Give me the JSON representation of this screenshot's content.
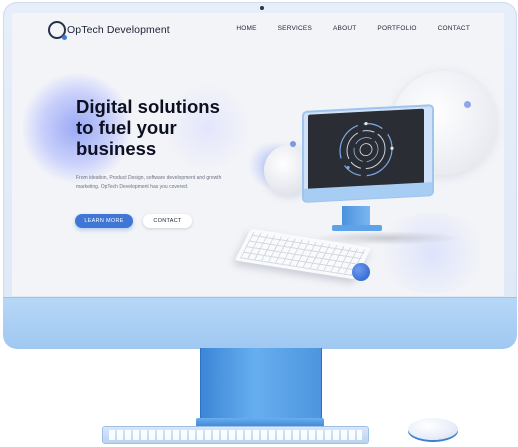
{
  "brand": {
    "name_prefix": "Op",
    "name_rest": "Tech Development"
  },
  "nav": {
    "items": [
      "HOME",
      "SERVICES",
      "ABOUT",
      "PORTFOLIO",
      "CONTACT"
    ]
  },
  "hero": {
    "title_lines": [
      "Digital solutions",
      "to fuel your",
      "business"
    ],
    "subtitle": "From ideation, Product Design, software development and growth marketing. OpTech Development has you covered.",
    "primary_button": "LEARN MORE",
    "secondary_button": "CONTACT"
  },
  "colors": {
    "accent": "#3e77d6",
    "device": "#9fc8f1",
    "text_dark": "#0c1020"
  },
  "icons": [
    "optech-logo-icon",
    "monitor-illustration",
    "keyboard-illustration",
    "mouse-illustration"
  ]
}
